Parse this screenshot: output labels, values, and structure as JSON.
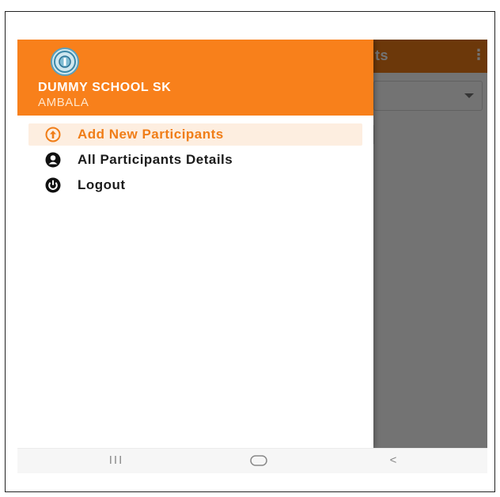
{
  "background_app": {
    "title_fragment": "ts",
    "more_icon": "more-vert-icon",
    "dropdown_icon": "caret-down-icon"
  },
  "drawer": {
    "logo_icon": "school-logo-icon",
    "school_name": "DUMMY SCHOOL SK",
    "school_city": "AMBALA",
    "items": [
      {
        "label": "Add New Participants",
        "icon": "arrow-up-circle-icon",
        "active": true
      },
      {
        "label": "All Participants Details",
        "icon": "person-circle-icon",
        "active": false
      },
      {
        "label": "Logout",
        "icon": "power-icon",
        "active": false
      }
    ]
  },
  "navbar": {
    "recents": "III",
    "home": "home-icon",
    "back": "<"
  },
  "colors": {
    "brand_orange": "#f8801b",
    "active_bg": "#fdeee0",
    "text_dark": "#1b1b1b"
  }
}
